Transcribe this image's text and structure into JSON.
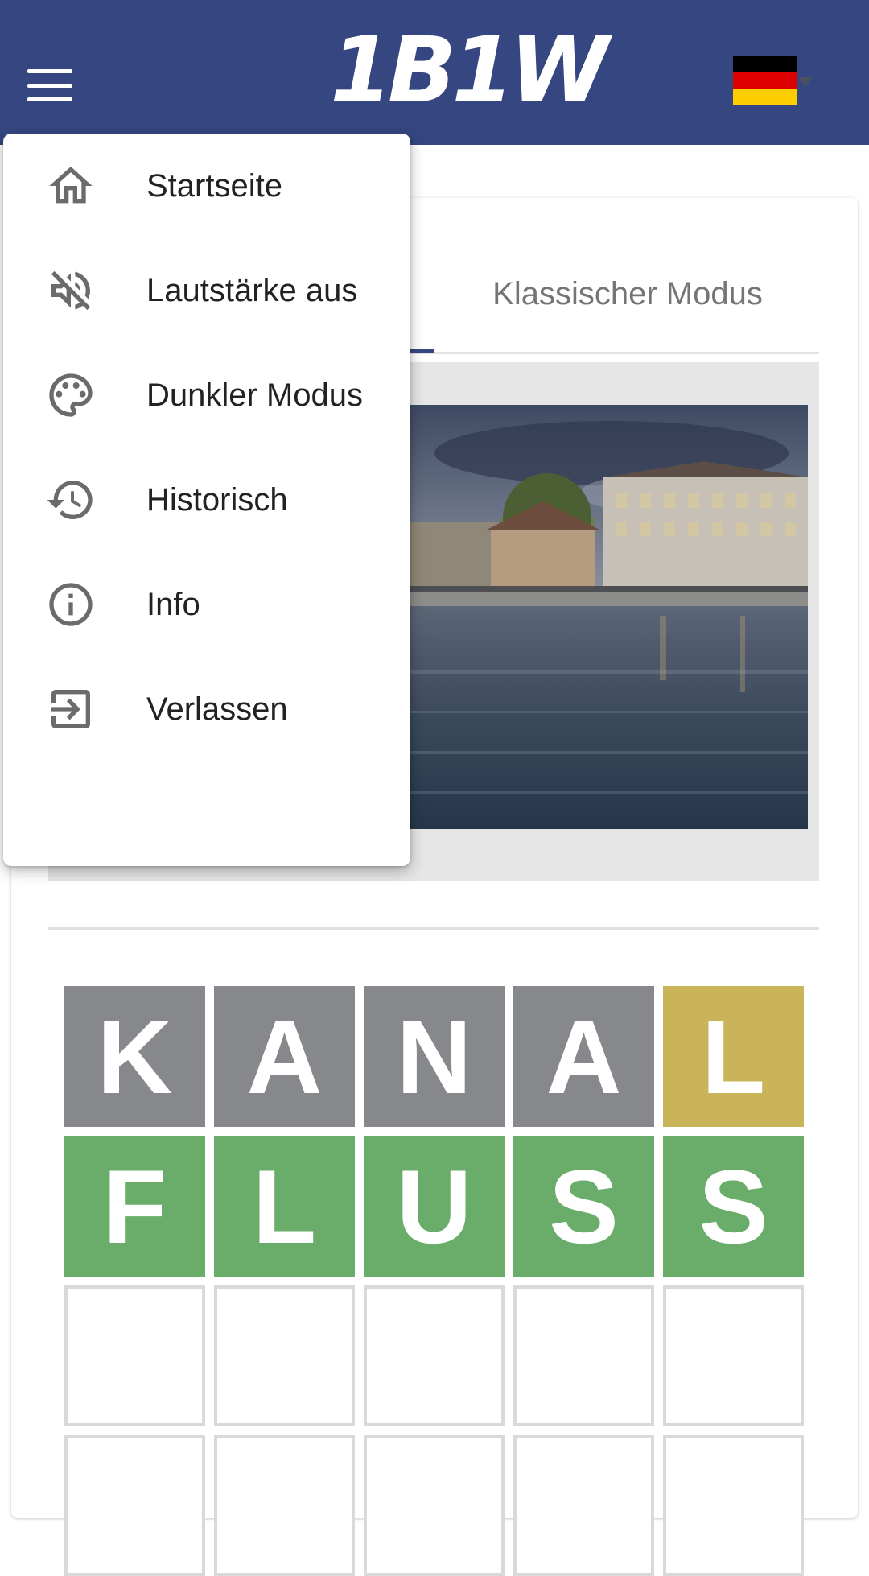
{
  "header": {
    "logo_text": "1B1W",
    "language_flag": "german-flag-icon",
    "menu_icon": "hamburger-icon",
    "brand_color": "#364681"
  },
  "tabs": {
    "classic_label": "Klassischer Modus"
  },
  "menu": {
    "items": [
      {
        "label": "Startseite",
        "icon": "home-icon"
      },
      {
        "label": "Lautstärke aus",
        "icon": "volume-off-icon"
      },
      {
        "label": "Dunkler Modus",
        "icon": "palette-icon"
      },
      {
        "label": "Historisch",
        "icon": "history-icon"
      },
      {
        "label": "Info",
        "icon": "info-icon"
      },
      {
        "label": "Verlassen",
        "icon": "exit-icon"
      }
    ]
  },
  "puzzle_image": "river-city-waterfront-photo",
  "grid": {
    "colors": {
      "absent": "#87888b",
      "present": "#c9b45a",
      "correct": "#6aac6a"
    },
    "rows": [
      [
        {
          "letter": "K",
          "state": "absent"
        },
        {
          "letter": "A",
          "state": "absent"
        },
        {
          "letter": "N",
          "state": "absent"
        },
        {
          "letter": "A",
          "state": "absent"
        },
        {
          "letter": "L",
          "state": "present"
        }
      ],
      [
        {
          "letter": "F",
          "state": "correct"
        },
        {
          "letter": "L",
          "state": "correct"
        },
        {
          "letter": "U",
          "state": "correct"
        },
        {
          "letter": "S",
          "state": "correct"
        },
        {
          "letter": "S",
          "state": "correct"
        }
      ],
      [
        {
          "letter": "",
          "state": "empty"
        },
        {
          "letter": "",
          "state": "empty"
        },
        {
          "letter": "",
          "state": "empty"
        },
        {
          "letter": "",
          "state": "empty"
        },
        {
          "letter": "",
          "state": "empty"
        }
      ],
      [
        {
          "letter": "",
          "state": "empty"
        },
        {
          "letter": "",
          "state": "empty"
        },
        {
          "letter": "",
          "state": "empty"
        },
        {
          "letter": "",
          "state": "empty"
        },
        {
          "letter": "",
          "state": "empty"
        }
      ]
    ]
  }
}
